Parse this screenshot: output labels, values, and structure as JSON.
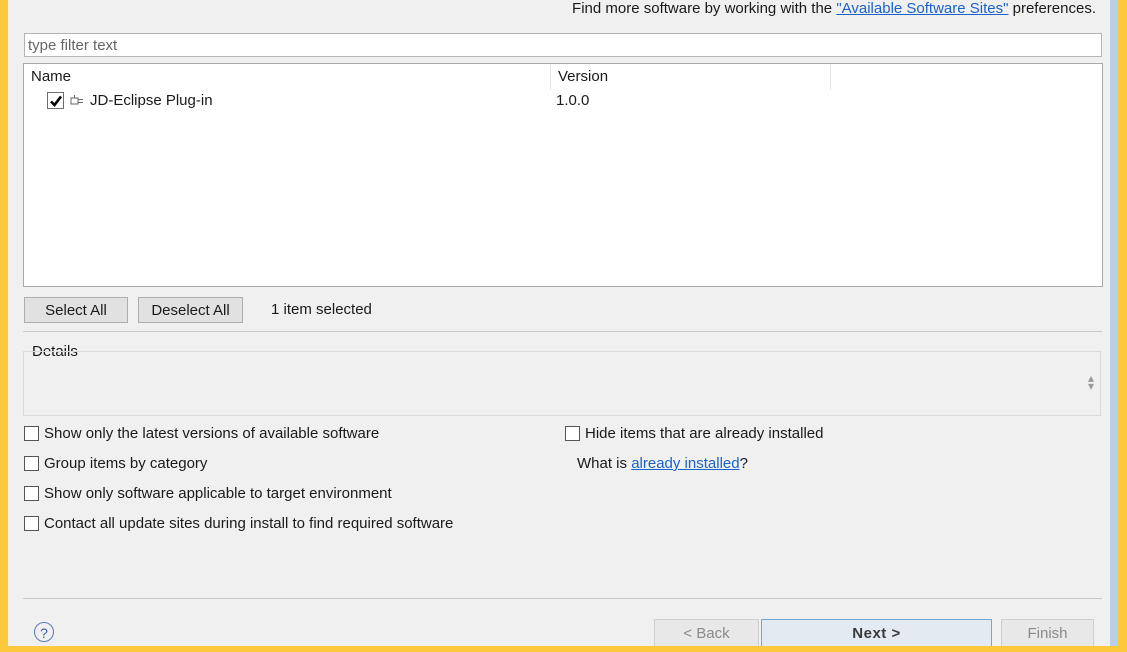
{
  "header": {
    "text_before": "Find more software by working with the ",
    "link": "\"Available Software Sites\"",
    "text_after": " preferences."
  },
  "filter": {
    "placeholder": "type filter text",
    "value": ""
  },
  "table": {
    "columns": [
      "Name",
      "Version",
      ""
    ],
    "rows": [
      {
        "name": "JD-Eclipse Plug-in",
        "version": "1.0.0",
        "checked": true,
        "icon": "plugin-icon"
      }
    ]
  },
  "selection": {
    "select_all": "Select All",
    "deselect_all": "Deselect All",
    "count_text": "1 item selected"
  },
  "details": {
    "label": "Details"
  },
  "options": {
    "latest_versions": "Show only the latest versions of available software",
    "group_by_category": "Group items by category",
    "applicable_target": "Show only software applicable to target environment",
    "contact_sites": "Contact all update sites during install to find required software",
    "hide_installed": "Hide items that are already installed",
    "what_is_prefix": "What is ",
    "what_is_link": "already installed",
    "what_is_suffix": "?"
  },
  "footer": {
    "help_icon": "help-icon",
    "back": "< Back",
    "next": "Next >",
    "finish": "Finish"
  },
  "colors": {
    "link": "#1a63c6",
    "background": "#f0f0f0",
    "outer_border": "#fcc93c"
  }
}
